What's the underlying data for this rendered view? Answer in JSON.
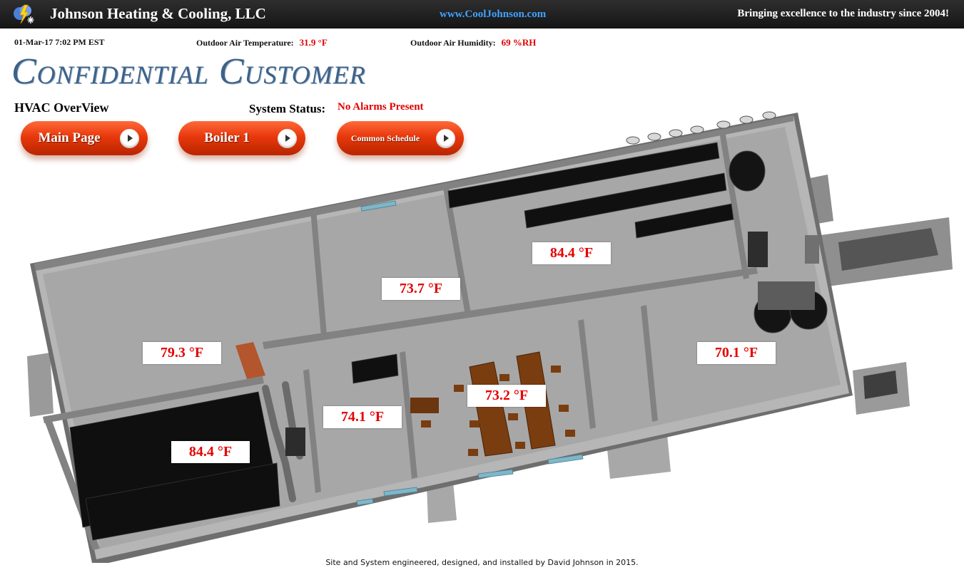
{
  "header": {
    "company": "Johnson Heating & Cooling, LLC",
    "website": "www.CoolJohnson.com",
    "tagline": "Bringing excellence to the industry since 2004!",
    "logo_icon": "lightning-snowflake-icon"
  },
  "info": {
    "datetime": "01-Mar-17 7:02 PM EST",
    "outdoor_temp_label": "Outdoor Air Temperature:",
    "outdoor_temp_value": "31.9 °F",
    "outdoor_humidity_label": "Outdoor Air Humidity:",
    "outdoor_humidity_value": "69 %RH"
  },
  "customer_title": "Confidential Customer",
  "overview_title": "HVAC OverView",
  "system_status": {
    "label": "System Status:",
    "value": "No Alarms Present"
  },
  "buttons": {
    "main_page": "Main Page",
    "boiler1": "Boiler 1",
    "common_schedule": "Common Schedule"
  },
  "zones": {
    "north_center": "84.4 °F",
    "center_room": "73.7 °F",
    "west_room": "79.3 °F",
    "east_room": "70.1 °F",
    "conference": "73.2 °F",
    "restroom_area": "74.1 °F",
    "southwest": "84.4 °F"
  },
  "colors": {
    "accent": "#e8380c",
    "alarm_text": "#e60000",
    "title_blue": "#3d6289",
    "link_blue": "#3fa3ff"
  },
  "footer": "Site and System engineered, designed, and installed by David Johnson in 2015."
}
